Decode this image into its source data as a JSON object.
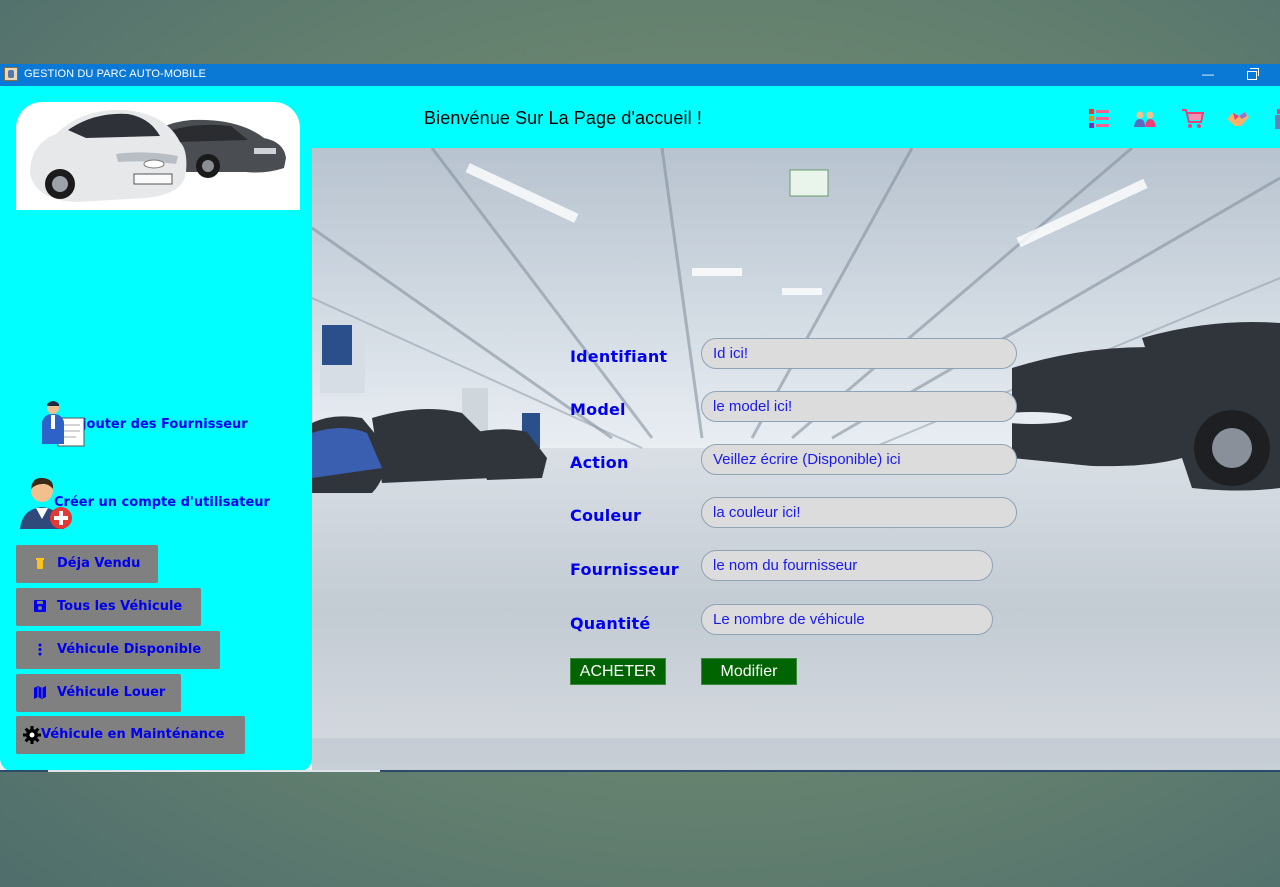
{
  "window": {
    "title": "GESTION DU PARC AUTO-MOBILE",
    "minimize": "—"
  },
  "header": {
    "welcome": "Bienvénue Sur La Page d'accueil !"
  },
  "header_icons": [
    "list-icon",
    "users-icon",
    "cart-icon",
    "handshake-icon",
    "more-icon"
  ],
  "sidebar": {
    "links": [
      {
        "label": "Ajouter des Fournisseur",
        "icon": "supplier-clipboard-icon"
      },
      {
        "label": "Créer un compte d'utilisateur",
        "icon": "add-user-icon"
      }
    ],
    "buttons": [
      {
        "label": "Déja Vendu",
        "icon": "trash-icon"
      },
      {
        "label": "Tous les Véhicule",
        "icon": "save-icon"
      },
      {
        "label": "Véhicule Disponible",
        "icon": "vertical-dots-icon"
      },
      {
        "label": "Véhicule Louer",
        "icon": "map-icon"
      },
      {
        "label": "Véhicule en Mainténance",
        "icon": "gear-icon"
      }
    ]
  },
  "form": {
    "fields": [
      {
        "label": "Identifiant",
        "placeholder": "Id ici!"
      },
      {
        "label": "Model",
        "placeholder": "le model ici!"
      },
      {
        "label": "Action",
        "placeholder": "Veillez écrire (Disponible) ici"
      },
      {
        "label": "Couleur",
        "placeholder": "la couleur ici!"
      },
      {
        "label": "Fournisseur",
        "placeholder": "le nom du fournisseur"
      },
      {
        "label": "Quantité",
        "placeholder": "Le nombre de véhicule"
      }
    ],
    "buy_label": "ACHETER",
    "edit_label": "Modifier"
  },
  "colors": {
    "sidebar": "#00ffff",
    "titlebar": "#0a79d6",
    "label_text": "#0000ee",
    "action_button": "#006400"
  }
}
